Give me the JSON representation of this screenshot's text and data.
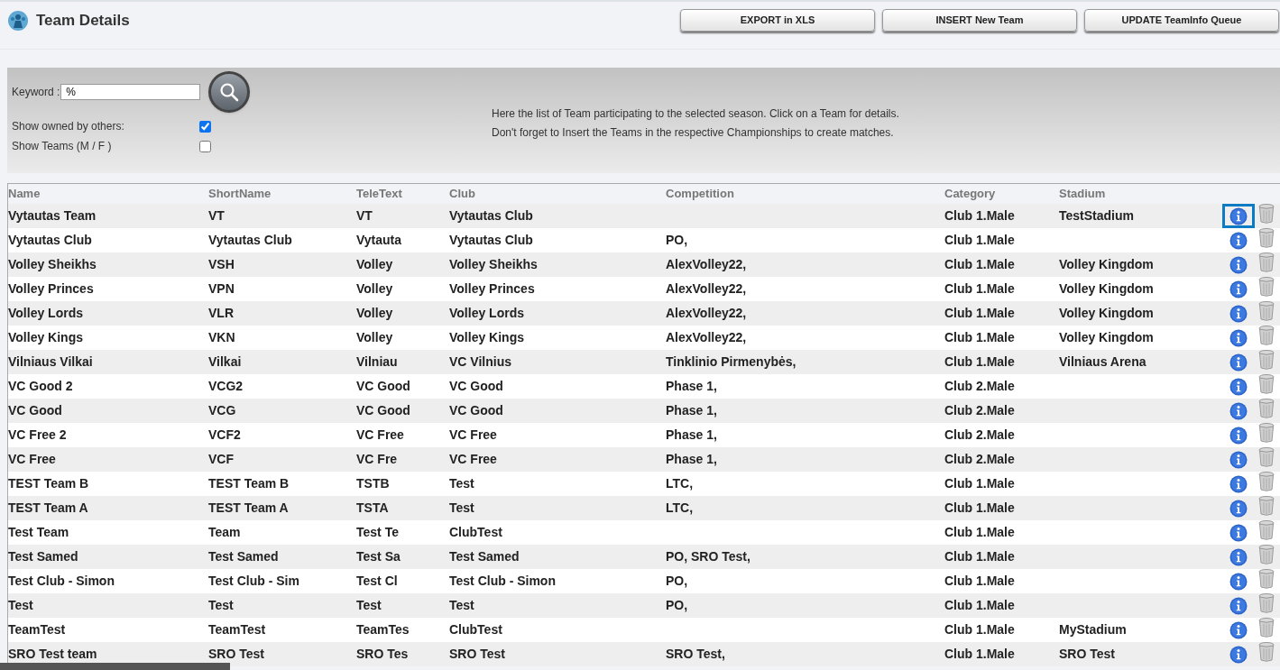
{
  "page": {
    "title": "Team Details"
  },
  "toolbar": {
    "buttons": [
      "EXPORT in XLS",
      "INSERT New Team",
      "UPDATE TeamInfo Queue"
    ]
  },
  "filters": {
    "keyword": {
      "label": "Keyword :",
      "value": "%"
    },
    "options": [
      {
        "label": "Show owned by others:",
        "checked": true
      },
      {
        "label": "Show Teams (M / F )",
        "checked": false
      }
    ],
    "hint": [
      "Here the list of Team participating to the selected season. Click on a Team for details.",
      "Don't forget to Insert the Teams in the respective Championships to create matches."
    ]
  },
  "table": {
    "columns": [
      "Name",
      "ShortName",
      "TeleText",
      "Club",
      "Competition",
      "Category",
      "Stadium"
    ],
    "rows": [
      {
        "cells": [
          "Vytautas Team",
          "VT",
          "VT",
          "Vytautas Club",
          "",
          "Club 1.Male",
          "TestStadium"
        ],
        "focused": true
      },
      {
        "cells": [
          "Vytautas Club",
          "Vytautas Club",
          "Vytauta",
          "Vytautas Club",
          "PO,",
          "Club 1.Male",
          ""
        ],
        "focused": false
      },
      {
        "cells": [
          "Volley Sheikhs",
          "VSH",
          "Volley",
          "Volley Sheikhs",
          "AlexVolley22,",
          "Club 1.Male",
          "Volley Kingdom"
        ],
        "focused": false
      },
      {
        "cells": [
          "Volley Princes",
          "VPN",
          "Volley",
          "Volley Princes",
          "AlexVolley22,",
          "Club 1.Male",
          "Volley Kingdom"
        ],
        "focused": false
      },
      {
        "cells": [
          "Volley Lords",
          "VLR",
          "Volley",
          "Volley Lords",
          "AlexVolley22,",
          "Club 1.Male",
          "Volley Kingdom"
        ],
        "focused": false
      },
      {
        "cells": [
          "Volley Kings",
          "VKN",
          "Volley",
          "Volley Kings",
          "AlexVolley22,",
          "Club 1.Male",
          "Volley Kingdom"
        ],
        "focused": false
      },
      {
        "cells": [
          "Vilniaus Vilkai",
          "Vilkai",
          "Vilniau",
          "VC Vilnius",
          "Tinklinio Pirmenybės,",
          "Club 1.Male",
          "Vilniaus Arena"
        ],
        "focused": false
      },
      {
        "cells": [
          "VC Good 2",
          "VCG2",
          "VC Good",
          "VC Good",
          "Phase 1,",
          "Club 2.Male",
          ""
        ],
        "focused": false
      },
      {
        "cells": [
          "VC Good",
          "VCG",
          "VC Good",
          "VC Good",
          "Phase 1,",
          "Club 2.Male",
          ""
        ],
        "focused": false
      },
      {
        "cells": [
          "VC Free 2",
          "VCF2",
          "VC Free",
          "VC Free",
          "Phase 1,",
          "Club 2.Male",
          ""
        ],
        "focused": false
      },
      {
        "cells": [
          "VC Free",
          "VCF",
          "VC Fre",
          "VC Free",
          "Phase 1,",
          "Club 2.Male",
          ""
        ],
        "focused": false
      },
      {
        "cells": [
          "TEST Team B",
          "TEST Team B",
          "TSTB",
          "Test",
          "LTC,",
          "Club 1.Male",
          ""
        ],
        "focused": false
      },
      {
        "cells": [
          "TEST Team A",
          "TEST Team A",
          "TSTA",
          "Test",
          "LTC,",
          "Club 1.Male",
          ""
        ],
        "focused": false
      },
      {
        "cells": [
          "Test Team",
          "Team",
          "Test Te",
          "ClubTest",
          "",
          "Club 1.Male",
          ""
        ],
        "focused": false
      },
      {
        "cells": [
          "Test Samed",
          "Test Samed",
          "Test Sa",
          "Test Samed",
          "PO, SRO Test,",
          "Club 1.Male",
          ""
        ],
        "focused": false
      },
      {
        "cells": [
          "Test Club - Simon",
          "Test Club - Sim",
          "Test Cl",
          "Test Club - Simon",
          "PO,",
          "Club 1.Male",
          ""
        ],
        "focused": false
      },
      {
        "cells": [
          "Test",
          "Test",
          "Test",
          "Test",
          "PO,",
          "Club 1.Male",
          ""
        ],
        "focused": false
      },
      {
        "cells": [
          "TeamTest",
          "TeamTest",
          "TeamTes",
          "ClubTest",
          "",
          "Club 1.Male",
          "MyStadium"
        ],
        "focused": false
      },
      {
        "cells": [
          "SRO Test team",
          "SRO Test",
          "SRO Tes",
          "SRO Test",
          "SRO Test,",
          "Club 1.Male",
          "SRO Test"
        ],
        "focused": false
      }
    ]
  }
}
